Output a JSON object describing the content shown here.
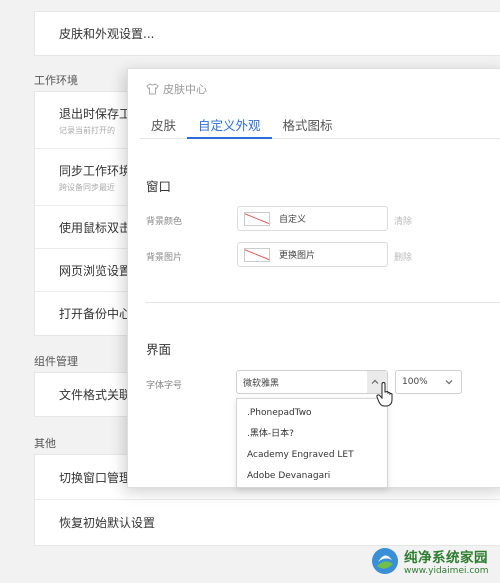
{
  "background": {
    "top_item": "皮肤和外观设置...",
    "section_work": "工作环境",
    "work_items": [
      {
        "title": "退出时保存工",
        "subtitle": "记录当前打开的"
      },
      {
        "title": "同步工作环境",
        "subtitle": "跨设备同步最近"
      },
      {
        "title": "使用鼠标双击"
      },
      {
        "title": "网页浏览设置"
      },
      {
        "title": "打开备份中心"
      }
    ],
    "section_components": "组件管理",
    "component_items": [
      {
        "title": "文件格式关联"
      }
    ],
    "section_other": "其他",
    "other_items": [
      {
        "title": "切换窗口管理"
      },
      {
        "title": "恢复初始默认设置"
      }
    ]
  },
  "dialog": {
    "title": "皮肤中心",
    "tabs": [
      "皮肤",
      "自定义外观",
      "格式图标"
    ],
    "active_tab": 1,
    "window_section": "窗口",
    "bg_color_label": "背景颜色",
    "bg_color_value": "自定义",
    "bg_color_action": "清除",
    "bg_image_label": "背景图片",
    "bg_image_value": "更换图片",
    "bg_image_action": "删除",
    "interface_section": "界面",
    "font_label": "字体字号",
    "font_value": "微软雅黑",
    "size_value": "100%",
    "font_options": [
      ".PhonepadTwo",
      ".黑体-日本?",
      "Academy Engraved LET",
      "Adobe Devanagari"
    ]
  },
  "watermark": {
    "name": "纯净系统家园",
    "url": "www.yidaimei.com"
  },
  "colors": {
    "accent": "#2b6fd6",
    "watermark": "#2f7d32"
  }
}
